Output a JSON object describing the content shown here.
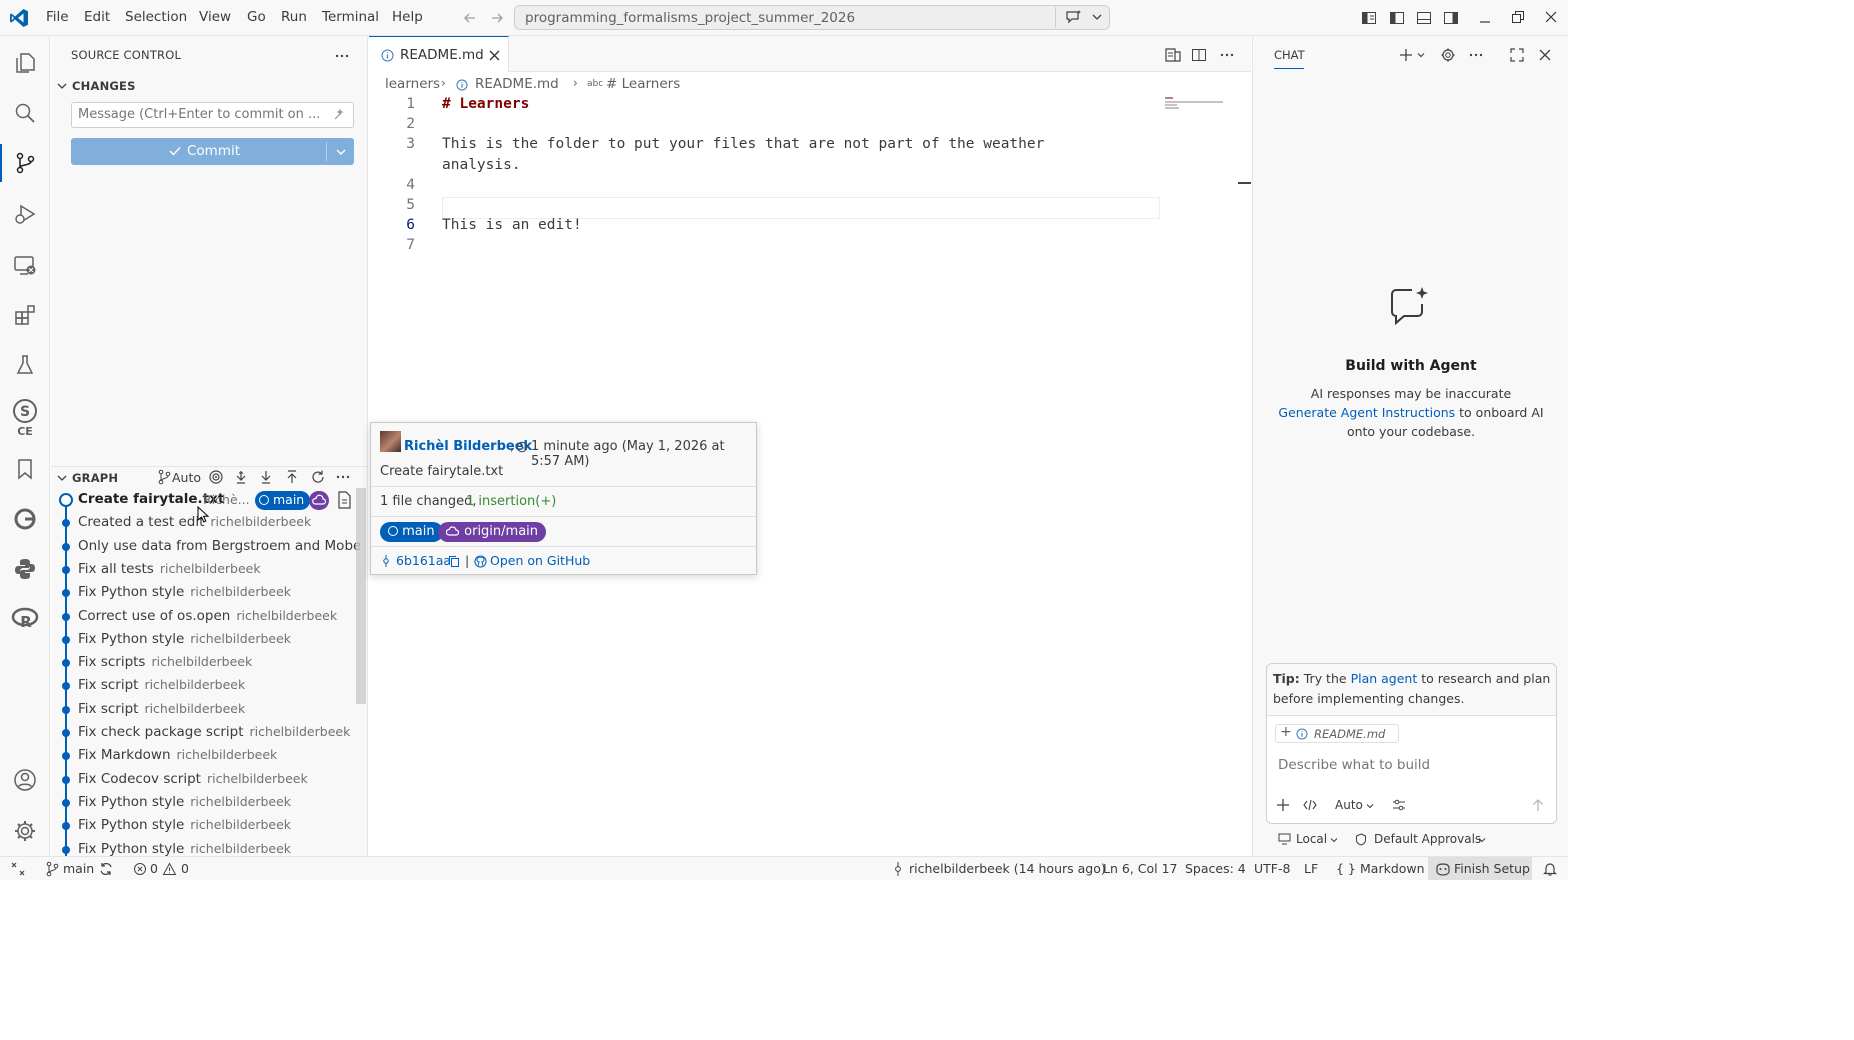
{
  "titlebar": {
    "menu": [
      "File",
      "Edit",
      "Selection",
      "View",
      "Go",
      "Run",
      "Terminal",
      "Help"
    ],
    "command_center": "programming_formalisms_project_summer_2026"
  },
  "sidebar": {
    "title": "SOURCE CONTROL",
    "changes_header": "CHANGES",
    "commit_placeholder": "Message (Ctrl+Enter to commit on ...",
    "commit_label": "Commit",
    "graph_header": "GRAPH",
    "graph_auto": "Auto",
    "graph_head": {
      "message": "Create fairytale.txt",
      "author": "Richè...",
      "branch": "main"
    },
    "graph_items": [
      {
        "message": "Created a test edit",
        "author": "richelbilderbeek"
      },
      {
        "message": "Only use data from Bergstroem and Mobe...",
        "author": ""
      },
      {
        "message": "Fix all tests",
        "author": "richelbilderbeek"
      },
      {
        "message": "Fix Python style",
        "author": "richelbilderbeek"
      },
      {
        "message": "Correct use of os.open",
        "author": "richelbilderbeek"
      },
      {
        "message": "Fix Python style",
        "author": "richelbilderbeek"
      },
      {
        "message": "Fix scripts",
        "author": "richelbilderbeek"
      },
      {
        "message": "Fix script",
        "author": "richelbilderbeek"
      },
      {
        "message": "Fix script",
        "author": "richelbilderbeek"
      },
      {
        "message": "Fix check package script",
        "author": "richelbilderbeek"
      },
      {
        "message": "Fix Markdown",
        "author": "richelbilderbeek"
      },
      {
        "message": "Fix Codecov script",
        "author": "richelbilderbeek"
      },
      {
        "message": "Fix Python style",
        "author": "richelbilderbeek"
      },
      {
        "message": "Fix Python style",
        "author": "richelbilderbeek"
      },
      {
        "message": "Fix Python style",
        "author": "richelbilderbeek"
      }
    ]
  },
  "editor": {
    "tab_label": "README.md",
    "breadcrumb": {
      "folder": "learners",
      "file": "README.md",
      "symbol": "# Learners"
    },
    "lines": [
      {
        "num": "1",
        "text": "# Learners"
      },
      {
        "num": "2",
        "text": ""
      },
      {
        "num": "3",
        "text": "This is the folder to put your files that are not part of the weather"
      },
      {
        "num": "",
        "text": "analysis."
      },
      {
        "num": "4",
        "text": ""
      },
      {
        "num": "5",
        "text": ""
      },
      {
        "num": "6",
        "text": "This is an edit!"
      },
      {
        "num": "7",
        "text": ""
      }
    ]
  },
  "hover": {
    "author": "Richèl Bilderbeek",
    "time": "1 minute ago (May 1, 2026 at 5:57 AM)",
    "message": "Create fairytale.txt",
    "files_changed": "1 file changed,",
    "insertions": "1 insertion(+)",
    "branch_local": "main",
    "branch_remote": "origin/main",
    "hash": "6b161aa",
    "sep": "|",
    "github_link": "Open on GitHub"
  },
  "chat": {
    "tab": "CHAT",
    "heading": "Build with Agent",
    "disclaimer": "AI responses may be inaccurate",
    "link": "Generate Agent Instructions",
    "link_suffix": "to onboard AI",
    "line3": "onto your codebase.",
    "tip_bold": "Tip:",
    "tip_pre": "Try the",
    "tip_link": "Plan agent",
    "tip_post": "to research and plan",
    "tip_line2": "before implementing changes.",
    "context_file": "README.md",
    "input_placeholder": "Describe what to build",
    "mode": "Auto",
    "local": "Local",
    "approvals": "Default Approvals"
  },
  "statusbar": {
    "branch": "main",
    "errors": "0",
    "warnings": "0",
    "blame": "richelbilderbeek (14 hours ago)",
    "position": "Ln 6, Col 17",
    "spaces": "Spaces: 4",
    "encoding": "UTF-8",
    "eol": "LF",
    "language": "Markdown",
    "finish_setup": "Finish Setup"
  },
  "colors": {
    "accent": "#005fb8",
    "remote": "#6f3fa5",
    "heading": "#800000"
  }
}
